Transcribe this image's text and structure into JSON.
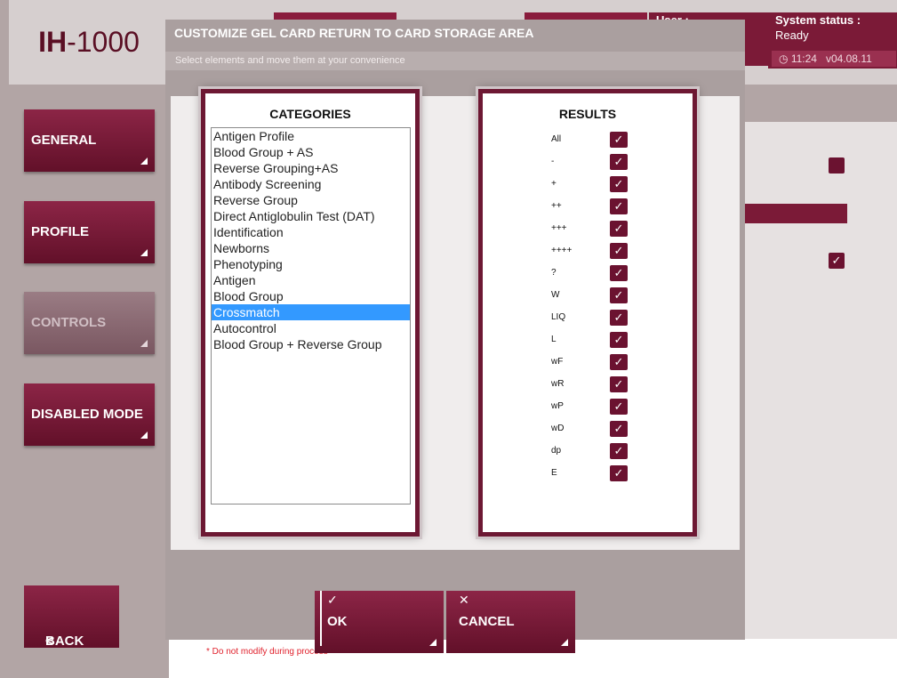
{
  "app": {
    "logo_bold": "IH",
    "logo_rest": "-1000"
  },
  "header": {
    "user_label": "User :",
    "status_label": "System status :",
    "status_value": "Ready",
    "time": "11:24",
    "version": "v04.08.11"
  },
  "nav": [
    {
      "label": "GENERAL",
      "enabled": true
    },
    {
      "label": "PROFILE",
      "enabled": true
    },
    {
      "label": "CONTROLS",
      "enabled": false
    },
    {
      "label": "DISABLED MODE",
      "enabled": true
    }
  ],
  "back_label": "BACK",
  "footnote": "* Do not modify during process",
  "modal": {
    "title": "CUSTOMIZE GEL CARD RETURN TO CARD STORAGE AREA",
    "subtitle": "Select elements and move them at your convenience",
    "categories_header": "CATEGORIES",
    "results_header": "RESULTS",
    "categories": [
      "Antigen Profile",
      "Blood Group + AS",
      "Reverse Grouping+AS",
      "Antibody Screening",
      "Reverse Group",
      "Direct Antiglobulin Test (DAT)",
      "Identification",
      "Newborns",
      "Phenotyping",
      "Antigen",
      "Blood Group",
      "Crossmatch",
      "Autocontrol",
      "Blood Group + Reverse Group"
    ],
    "selected_category": "Crossmatch",
    "results": [
      {
        "label": "All",
        "checked": true
      },
      {
        "label": "-",
        "checked": true
      },
      {
        "label": "+",
        "checked": true
      },
      {
        "label": "++",
        "checked": true
      },
      {
        "label": "+++",
        "checked": true
      },
      {
        "label": "++++",
        "checked": true
      },
      {
        "label": "?",
        "checked": true
      },
      {
        "label": "W",
        "checked": true
      },
      {
        "label": "LIQ",
        "checked": true
      },
      {
        "label": "L",
        "checked": true
      },
      {
        "label": "wF",
        "checked": true
      },
      {
        "label": "wR",
        "checked": true
      },
      {
        "label": "wP",
        "checked": true
      },
      {
        "label": "wD",
        "checked": true
      },
      {
        "label": "dp",
        "checked": true
      },
      {
        "label": "E",
        "checked": true
      }
    ],
    "ok_label": "OK",
    "cancel_label": "CANCEL"
  },
  "icons": {
    "check": "check-icon",
    "close": "close-icon",
    "clock": "clock-icon",
    "back": "chevron-left-icon"
  },
  "colors": {
    "brand": "#7b1a37",
    "selection": "#3399ff",
    "warning": "#e0212c"
  }
}
